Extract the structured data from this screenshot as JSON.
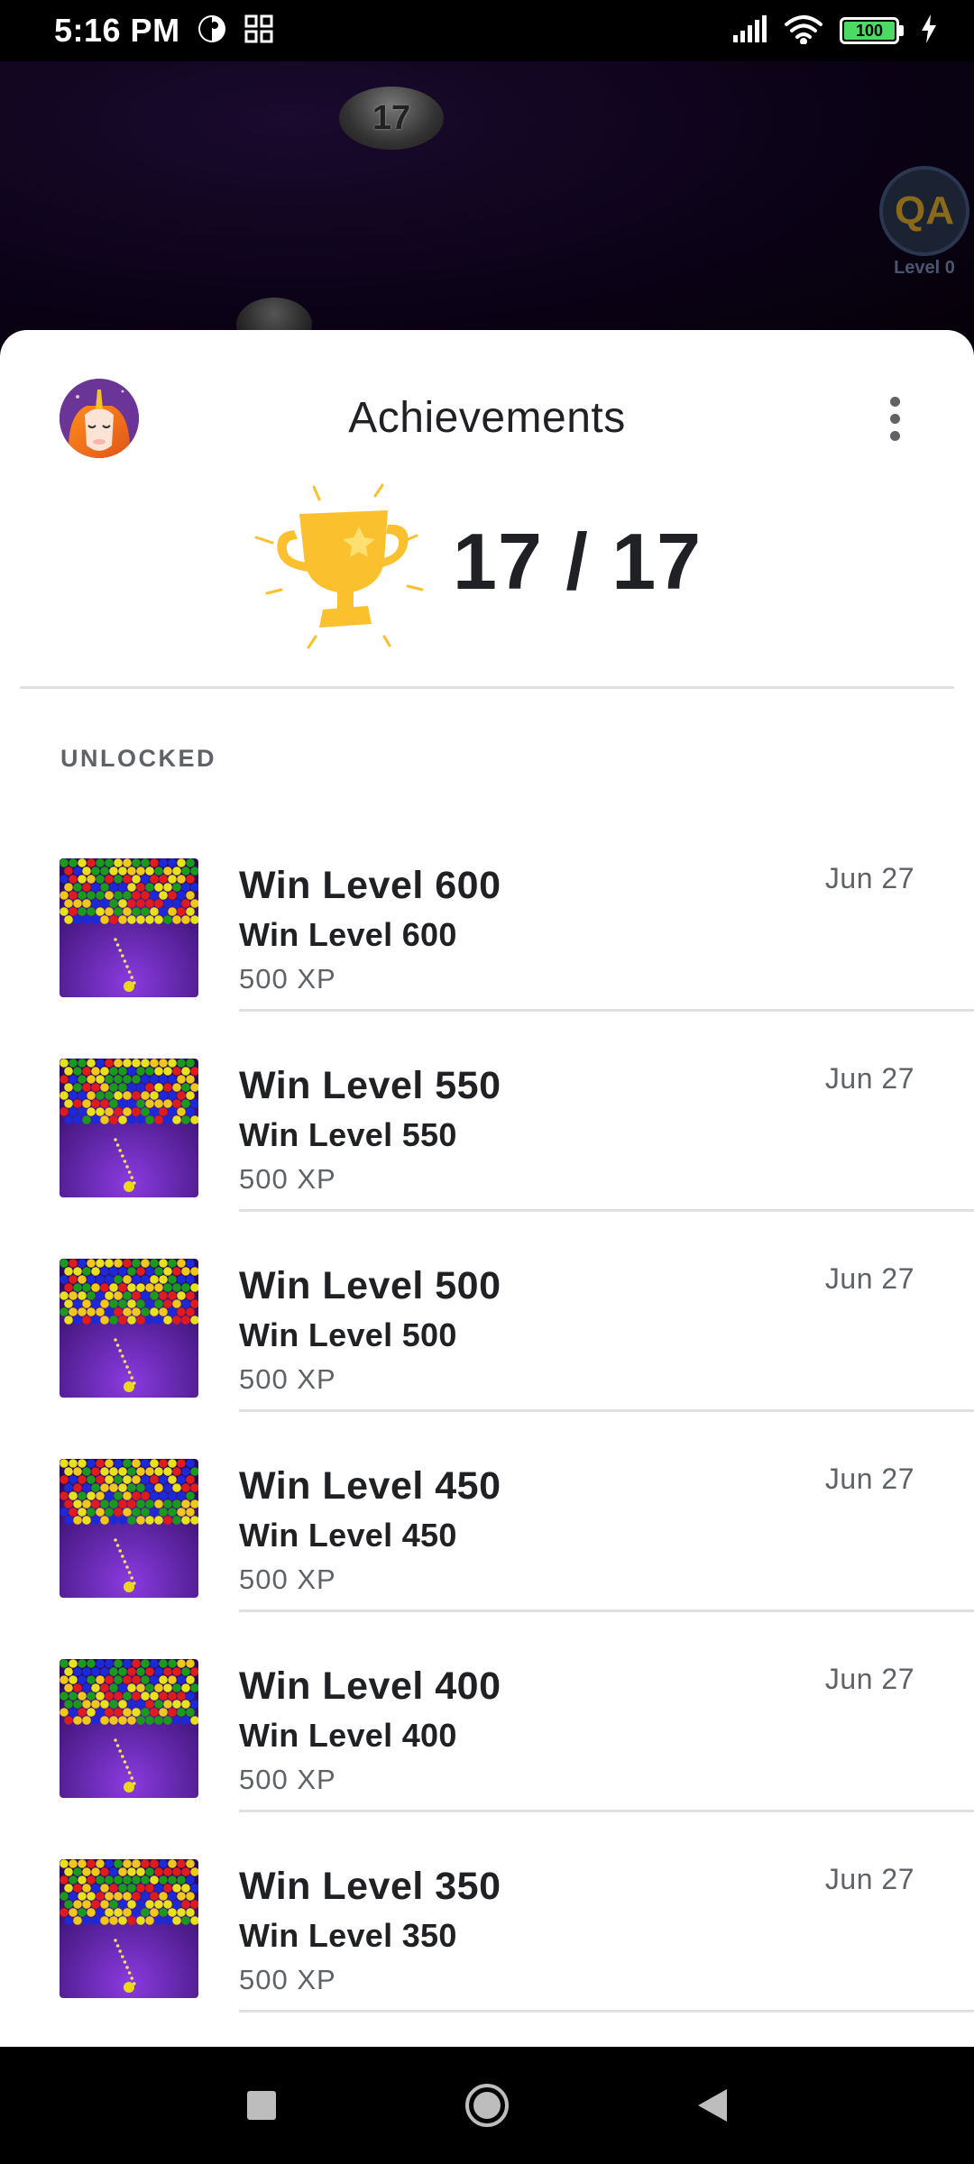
{
  "status_bar": {
    "time": "5:16 PM",
    "battery_level": "100",
    "icons": [
      "data-saver-icon",
      "qr-icon",
      "signal-icon",
      "wifi-icon",
      "battery-icon",
      "charging-icon"
    ]
  },
  "game_background": {
    "level_node_number": "17",
    "player_initials": "QA",
    "player_level": "Level 0"
  },
  "sheet": {
    "title": "Achievements",
    "more_icon": "more-vert-icon",
    "profile_icon": "unicorn-avatar-icon"
  },
  "summary": {
    "count": "17 / 17",
    "icon": "trophy-icon",
    "trophy_color": "#fbc02d"
  },
  "section": {
    "label": "UNLOCKED"
  },
  "achievements": [
    {
      "title": "Win Level 600",
      "description": "Win Level 600",
      "xp": "500 XP",
      "date": "Jun 27"
    },
    {
      "title": "Win Level 550",
      "description": "Win Level 550",
      "xp": "500 XP",
      "date": "Jun 27"
    },
    {
      "title": "Win Level 500",
      "description": "Win Level 500",
      "xp": "500 XP",
      "date": "Jun 27"
    },
    {
      "title": "Win Level 450",
      "description": "Win Level 450",
      "xp": "500 XP",
      "date": "Jun 27"
    },
    {
      "title": "Win Level 400",
      "description": "Win Level 400",
      "xp": "500 XP",
      "date": "Jun 27"
    },
    {
      "title": "Win Level 350",
      "description": "Win Level 350",
      "xp": "500 XP",
      "date": "Jun 27"
    }
  ],
  "nav_bar": {
    "icons": [
      "recents-icon",
      "home-icon",
      "back-icon"
    ]
  }
}
